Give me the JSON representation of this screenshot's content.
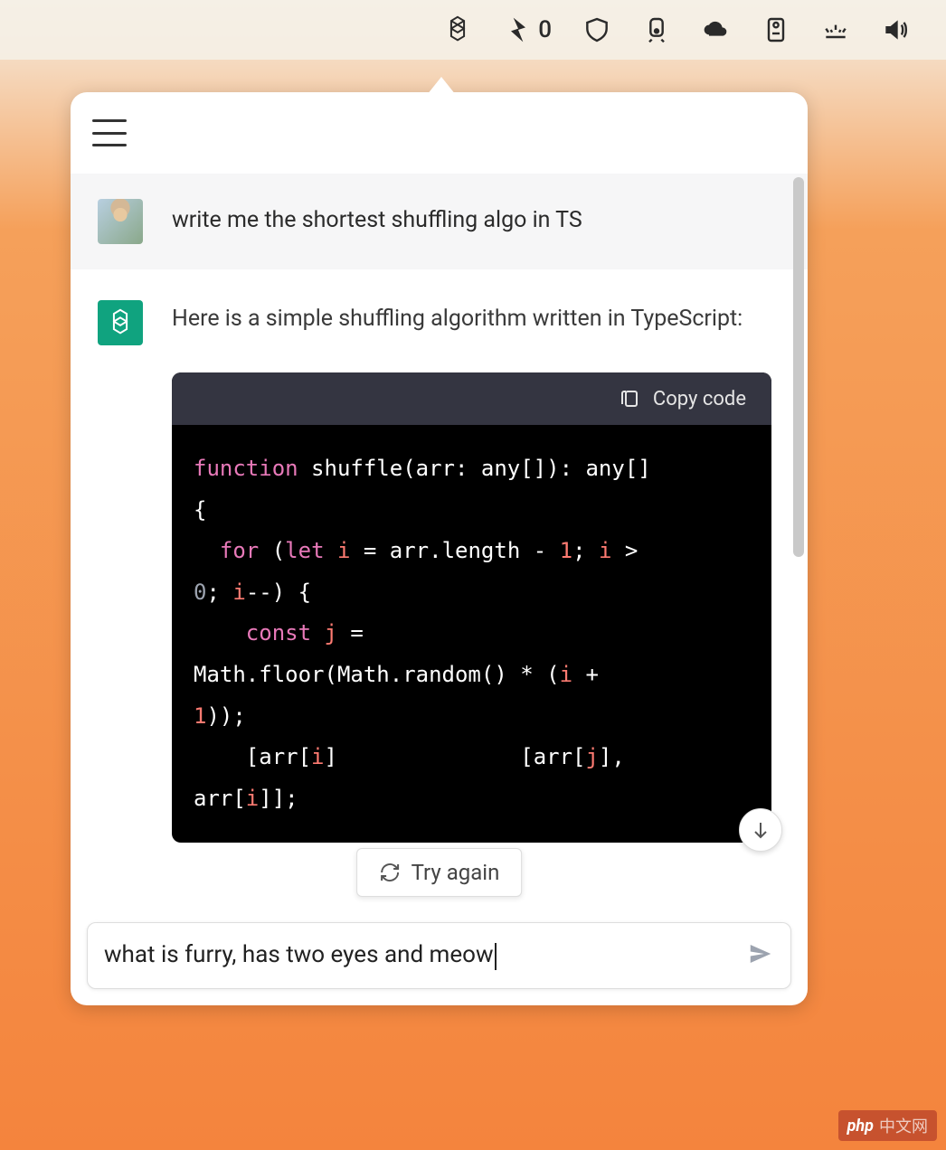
{
  "menubar": {
    "bolt_count": "0"
  },
  "chat": {
    "user_message": "write me the shortest shuffling algo in TS",
    "bot_intro": "Here is a simple shuffling algorithm written in TypeScript:",
    "copy_label": "Copy code",
    "code": {
      "line1_a": "function",
      "line1_b": " shuffle(arr: any[]): any[]",
      "line2": "{",
      "line3_a": "  for",
      "line3_b": " (",
      "line3_c": "let",
      "line3_d": " ",
      "line3_e": "i",
      "line3_f": " = arr.length - ",
      "line3_g": "1",
      "line3_h": "; ",
      "line3_i": "i",
      "line3_j": " > ",
      "line4_a": "0",
      "line4_b": "; ",
      "line4_c": "i",
      "line4_d": "--) {",
      "line5_a": "    const",
      "line5_b": " ",
      "line5_c": "j",
      "line5_d": " =",
      "line6_a": "Math.floor(Math.random() * (",
      "line6_b": "i",
      "line6_c": " + ",
      "line7_a": "1",
      "line7_b": "));",
      "line8_a": "    [arr[",
      "line8_b": "i",
      "line8_c": "]",
      "line8_gap": "              ",
      "line8_d": "[arr[",
      "line8_e": "j",
      "line8_f": "],",
      "line9_a": "arr[",
      "line9_b": "i",
      "line9_c": "]];"
    },
    "try_again_label": "Try again"
  },
  "input": {
    "value": "what is furry, has two eyes and meow"
  },
  "watermark": {
    "brand": "php",
    "site": "中文网"
  }
}
